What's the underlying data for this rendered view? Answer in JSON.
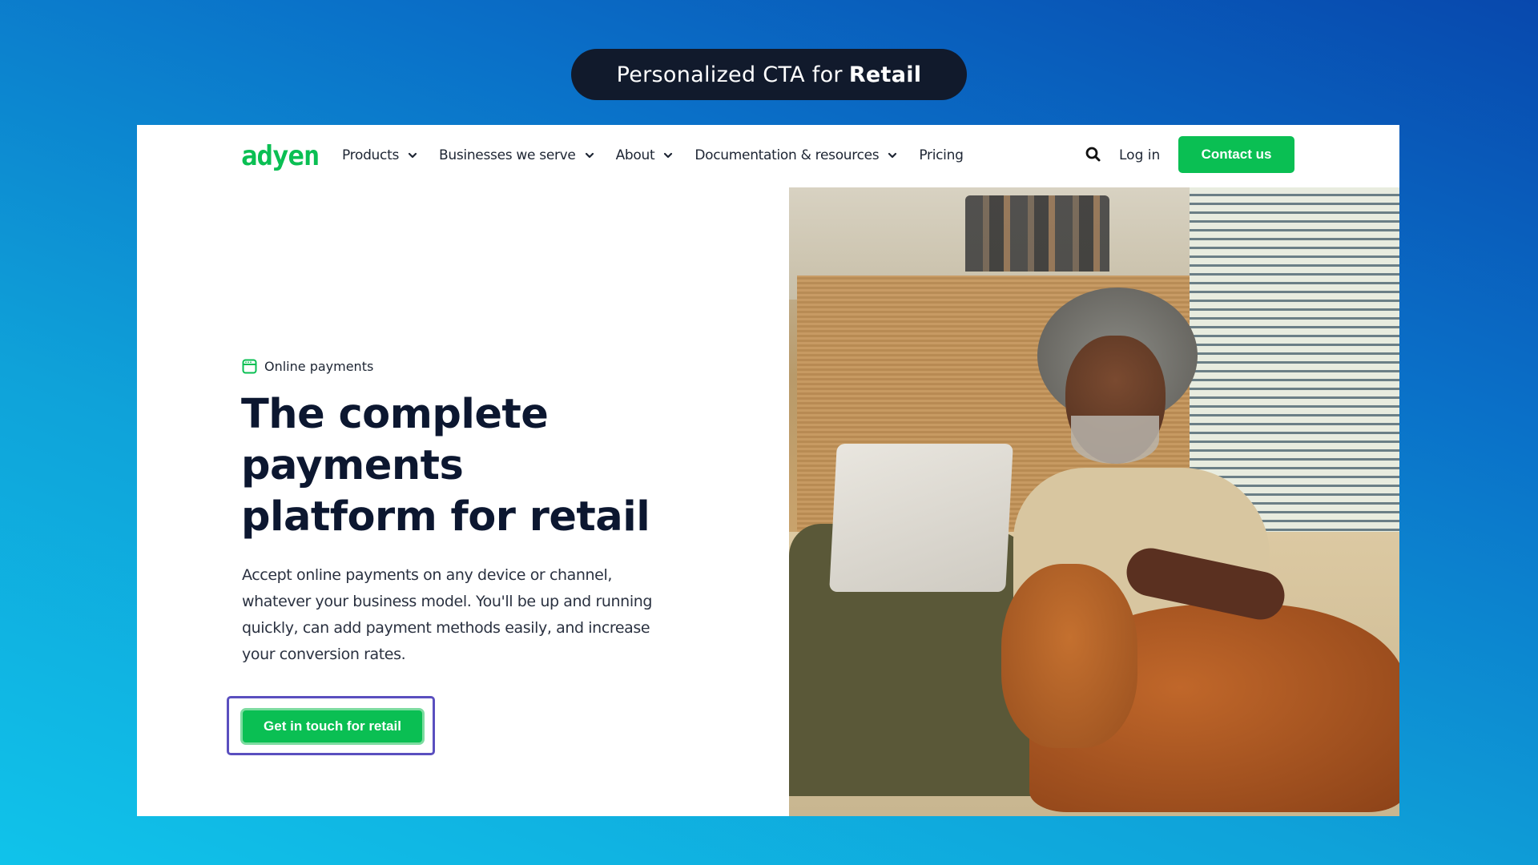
{
  "banner": {
    "prefix": "Personalized CTA for",
    "highlight": "Retail"
  },
  "nav": {
    "logo": "adyen",
    "items": [
      {
        "label": "Products",
        "has_dropdown": true
      },
      {
        "label": "Businesses we serve",
        "has_dropdown": true
      },
      {
        "label": "About",
        "has_dropdown": true
      },
      {
        "label": "Documentation & resources",
        "has_dropdown": true
      },
      {
        "label": "Pricing",
        "has_dropdown": false
      }
    ],
    "search_icon": "search-icon",
    "login": "Log in",
    "contact": "Contact us"
  },
  "hero": {
    "eyebrow_icon": "browser-window-icon",
    "eyebrow": "Online payments",
    "headline": "The complete payments platform for retail",
    "body": "Accept online payments on any device or channel, whatever your business model. You'll be up and running quickly, can add payment methods easily, and increase your conversion rates.",
    "cta": "Get in touch for retail",
    "image_alt": "Smiling man with gray hair using a laptop on a sofa while petting a brown dog"
  },
  "colors": {
    "brand_green": "#0abf53",
    "headline": "#0c1730",
    "banner_bg": "#111a2c",
    "highlight_outline": "#5a4fbf"
  }
}
